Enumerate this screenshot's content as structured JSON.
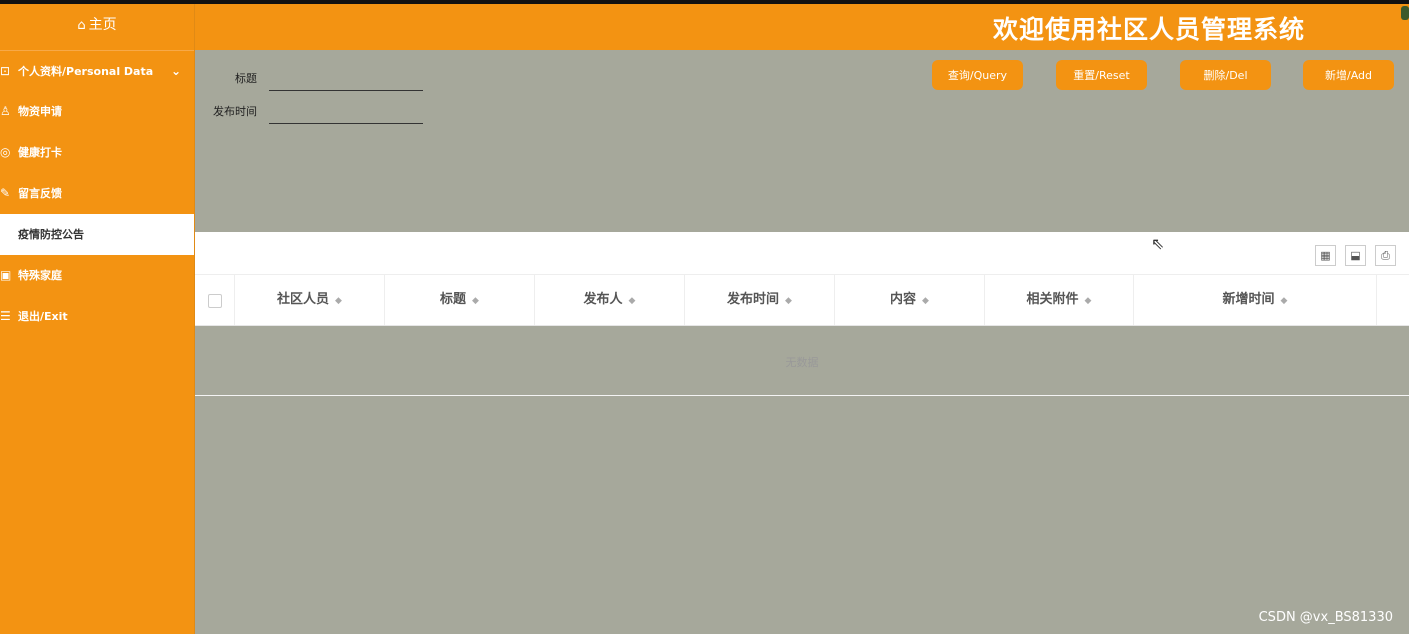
{
  "header": {
    "title": "欢迎使用社区人员管理系统"
  },
  "sidebar": {
    "home_label": "主页",
    "items": [
      {
        "label": "个人资料/Personal Data",
        "icon": "user-card-icon",
        "has_submenu": true
      },
      {
        "label": "物资申请",
        "icon": "person-icon"
      },
      {
        "label": "健康打卡",
        "icon": "camera-icon"
      },
      {
        "label": "留言反馈",
        "icon": "pencil-icon"
      },
      {
        "label": "疫情防控公告",
        "icon": "",
        "active": true
      },
      {
        "label": "特殊家庭",
        "icon": "document-icon"
      },
      {
        "label": "退出/Exit",
        "icon": "exit-icon"
      }
    ]
  },
  "search": {
    "title_label": "标题",
    "title_value": "",
    "date_label": "发布时间",
    "date_value": ""
  },
  "buttons": {
    "query": "查询/Query",
    "reset": "重置/Reset",
    "delete": "删除/Del",
    "add": "新增/Add"
  },
  "table": {
    "columns": [
      "社区人员",
      "标题",
      "发布人",
      "发布时间",
      "内容",
      "相关附件",
      "新增时间"
    ],
    "empty_text": "无数据"
  },
  "watermark": "CSDN @vx_BS81330",
  "colors": {
    "accent": "#f39312",
    "content_bg": "#a6a89b",
    "active_item_bg": "#ffffff"
  }
}
